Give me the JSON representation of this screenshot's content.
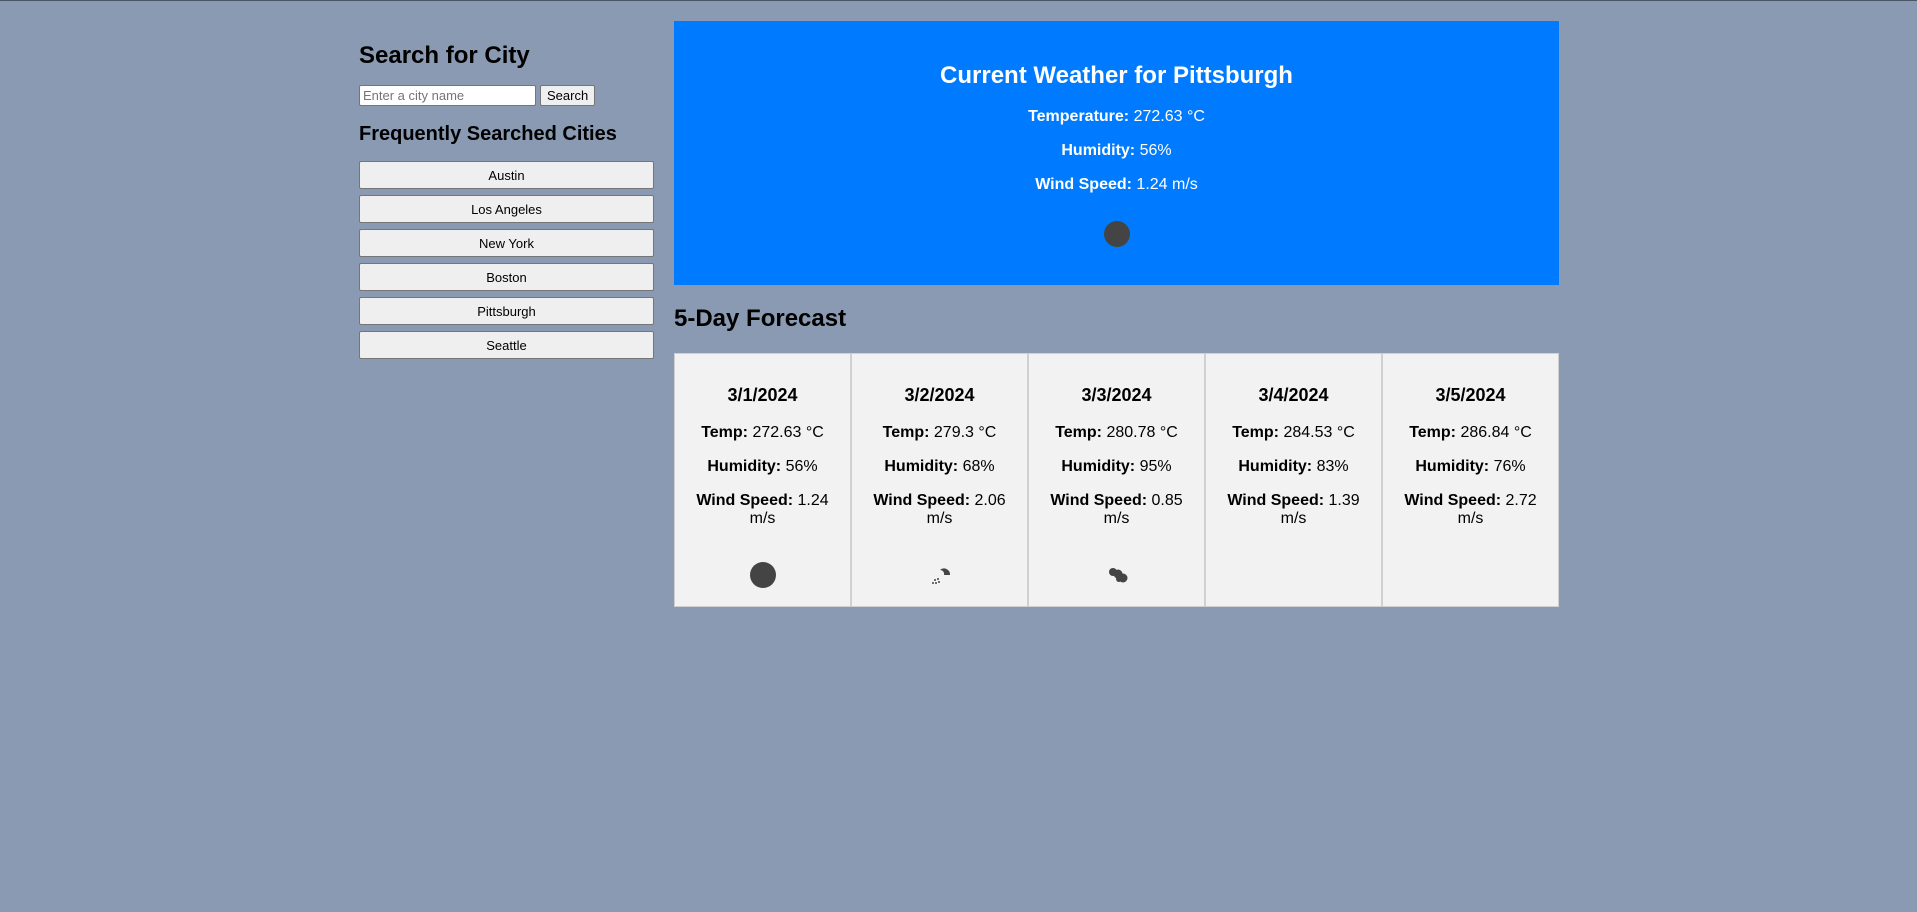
{
  "search": {
    "title": "Search for City",
    "placeholder": "Enter a city name",
    "button_label": "Search"
  },
  "frequent": {
    "title": "Frequently Searched Cities",
    "cities": [
      "Austin",
      "Los Angeles",
      "New York",
      "Boston",
      "Pittsburgh",
      "Seattle"
    ]
  },
  "current": {
    "title": "Current Weather for Pittsburgh",
    "temperature_label": "Temperature:",
    "temperature_value": "272.63 °C",
    "humidity_label": "Humidity:",
    "humidity_value": "56%",
    "wind_label": "Wind Speed:",
    "wind_value": "1.24 m/s",
    "icon": "dark-circle-icon",
    "bg_color": "#007bff"
  },
  "forecast": {
    "title": "5-Day Forecast",
    "days": [
      {
        "date": "3/1/2024",
        "temp_label": "Temp:",
        "temp": "272.63 °C",
        "humidity_label": "Humidity:",
        "humidity": "56%",
        "wind_label": "Wind Speed:",
        "wind": "1.24 m/s",
        "icon": "dark-circle-icon"
      },
      {
        "date": "3/2/2024",
        "temp_label": "Temp:",
        "temp": "279.3 °C",
        "humidity_label": "Humidity:",
        "humidity": "68%",
        "wind_label": "Wind Speed:",
        "wind": "2.06 m/s",
        "icon": "rain-cloud-icon"
      },
      {
        "date": "3/3/2024",
        "temp_label": "Temp:",
        "temp": "280.78 °C",
        "humidity_label": "Humidity:",
        "humidity": "95%",
        "wind_label": "Wind Speed:",
        "wind": "0.85 m/s",
        "icon": "clouds-icon"
      },
      {
        "date": "3/4/2024",
        "temp_label": "Temp:",
        "temp": "284.53 °C",
        "humidity_label": "Humidity:",
        "humidity": "83%",
        "wind_label": "Wind Speed:",
        "wind": "1.39 m/s",
        "icon": ""
      },
      {
        "date": "3/5/2024",
        "temp_label": "Temp:",
        "temp": "286.84 °C",
        "humidity_label": "Humidity:",
        "humidity": "76%",
        "wind_label": "Wind Speed:",
        "wind": "2.72 m/s",
        "icon": ""
      }
    ]
  }
}
